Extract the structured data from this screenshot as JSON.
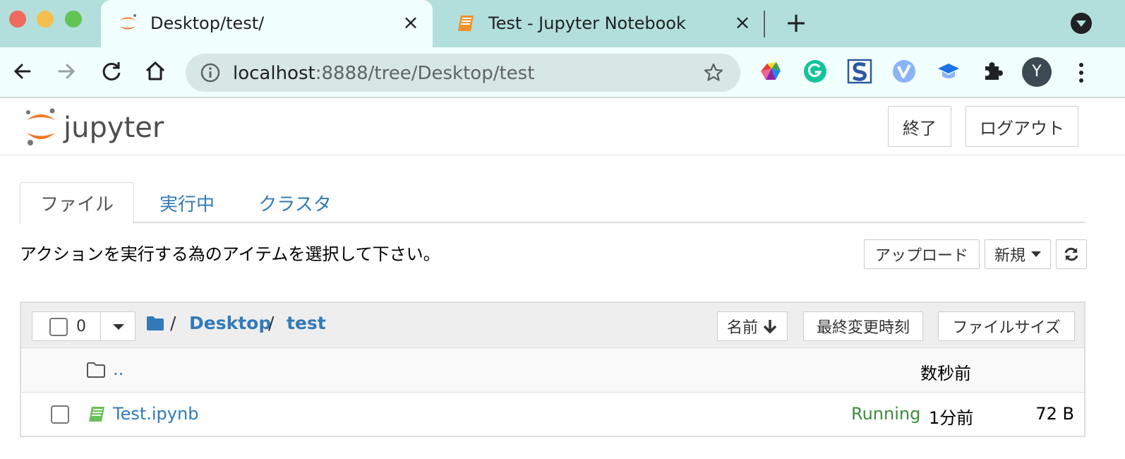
{
  "browser": {
    "tabs": [
      {
        "title": "Desktop/test/",
        "active": true,
        "favicon": "jupyter-logo-icon"
      },
      {
        "title": "Test - Jupyter Notebook",
        "active": false,
        "favicon": "notebook-icon"
      }
    ],
    "new_tab": "+",
    "address": {
      "host": "localhost",
      "path": ":8888/tree/Desktop/test"
    },
    "avatar_initial": "Y",
    "extensions": [
      "colorful-extension-icon",
      "grammarly-icon",
      "s-extension-icon",
      "v-extension-icon",
      "graduation-cap-icon",
      "puzzle-extensions-icon"
    ]
  },
  "header": {
    "logo_text": "jupyter",
    "quit_label": "終了",
    "logout_label": "ログアウト"
  },
  "tabs": [
    {
      "label": "ファイル",
      "active": true
    },
    {
      "label": "実行中",
      "active": false
    },
    {
      "label": "クラスタ",
      "active": false
    }
  ],
  "toolbar": {
    "hint": "アクションを実行する為のアイテムを選択して下さい。",
    "upload_label": "アップロード",
    "new_label": "新規"
  },
  "list": {
    "selected_count": "0",
    "breadcrumb": [
      {
        "sep": "/",
        "label": "Desktop"
      },
      {
        "sep": "/",
        "label": "test"
      }
    ],
    "sort": {
      "name": "名前",
      "modified": "最終変更時刻",
      "size": "ファイルサイズ"
    },
    "rows": [
      {
        "name": "..",
        "type": "folder",
        "status": "",
        "modified": "数秒前",
        "size": ""
      },
      {
        "name": "Test.ipynb",
        "type": "notebook",
        "status": "Running",
        "modified": "1分前",
        "size": "72 B"
      }
    ]
  },
  "colors": {
    "link": "#337ab7",
    "running": "#3c8b3c",
    "tabstrip": "#b2dfdb",
    "jupyter_orange": "#f37726"
  }
}
